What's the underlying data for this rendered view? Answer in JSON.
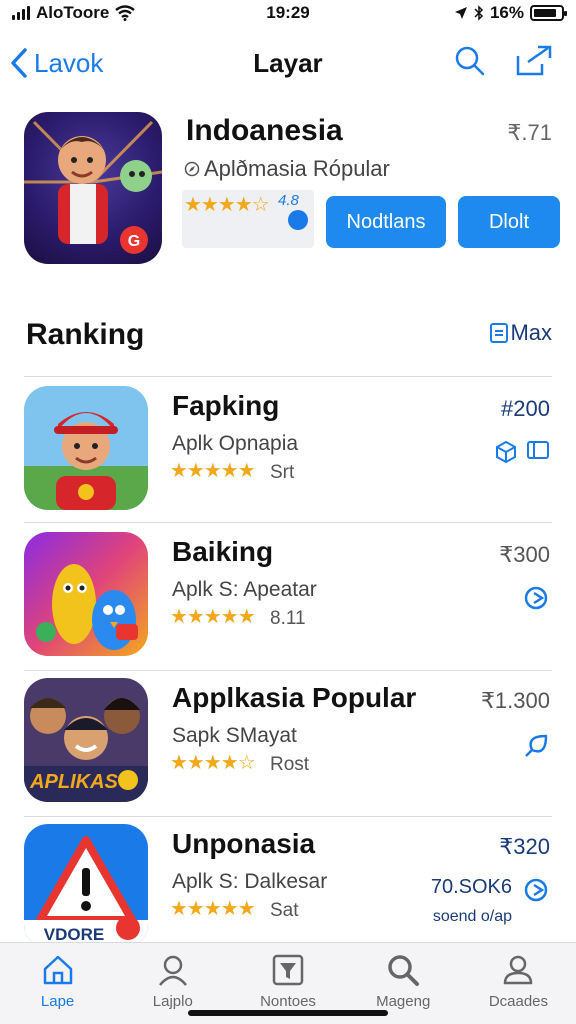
{
  "status": {
    "carrier": "AloToore",
    "time": "19:29",
    "battery": "16%",
    "battery_fill": 0.85
  },
  "nav": {
    "back_label": "Lavok",
    "title": "Layar"
  },
  "featured": {
    "title": "Indoanesia",
    "price": "₹.71",
    "subtitle": "Aplðmasia Rópular",
    "rating_stars": "★★★★☆",
    "rating_value": "4.8",
    "rating_fraction": 0.8,
    "button_primary": "Nodtlans",
    "button_secondary": "Dlolt"
  },
  "ranking": {
    "title": "Ranking",
    "more_label": "Max",
    "items": [
      {
        "title": "Fapking",
        "subtitle": "Aplk Opnapia",
        "stars": "★★★★★",
        "count": "Srt",
        "price": "#200",
        "rating_fraction": 1.0
      },
      {
        "title": "Baiking",
        "subtitle": "Aplk S: Apeatar",
        "stars": "★★★★★",
        "count": "8.11",
        "price": "₹300",
        "rating_fraction": 1.0
      },
      {
        "title": "Applkasia Popular",
        "subtitle": "Sapk SMayat",
        "stars": "★★★★☆",
        "count": "Rost",
        "price": "₹1.300",
        "rating_fraction": 0.8,
        "icon_text": "APLIKAS"
      },
      {
        "title": "Unponasia",
        "subtitle": "Aplk S: Dalkesar",
        "stars": "★★★★★",
        "count": "Sat",
        "price": "₹320",
        "rating_fraction": 1.0,
        "extra": "70.SOK6",
        "extra2": "soend o/ap",
        "icon_text": "VDORE"
      }
    ]
  },
  "tabs": [
    {
      "label": "Lape",
      "icon": "home-icon",
      "active": true
    },
    {
      "label": "Lajplo",
      "icon": "person-icon",
      "active": false
    },
    {
      "label": "Nontoes",
      "icon": "filter-icon",
      "active": false
    },
    {
      "label": "Mageng",
      "icon": "search-icon",
      "active": false
    },
    {
      "label": "Dcaades",
      "icon": "person-alt-icon",
      "active": false
    }
  ],
  "colors": {
    "accent": "#1e8af0",
    "star": "#f2a81d",
    "text_dark": "#1a3a7a"
  }
}
